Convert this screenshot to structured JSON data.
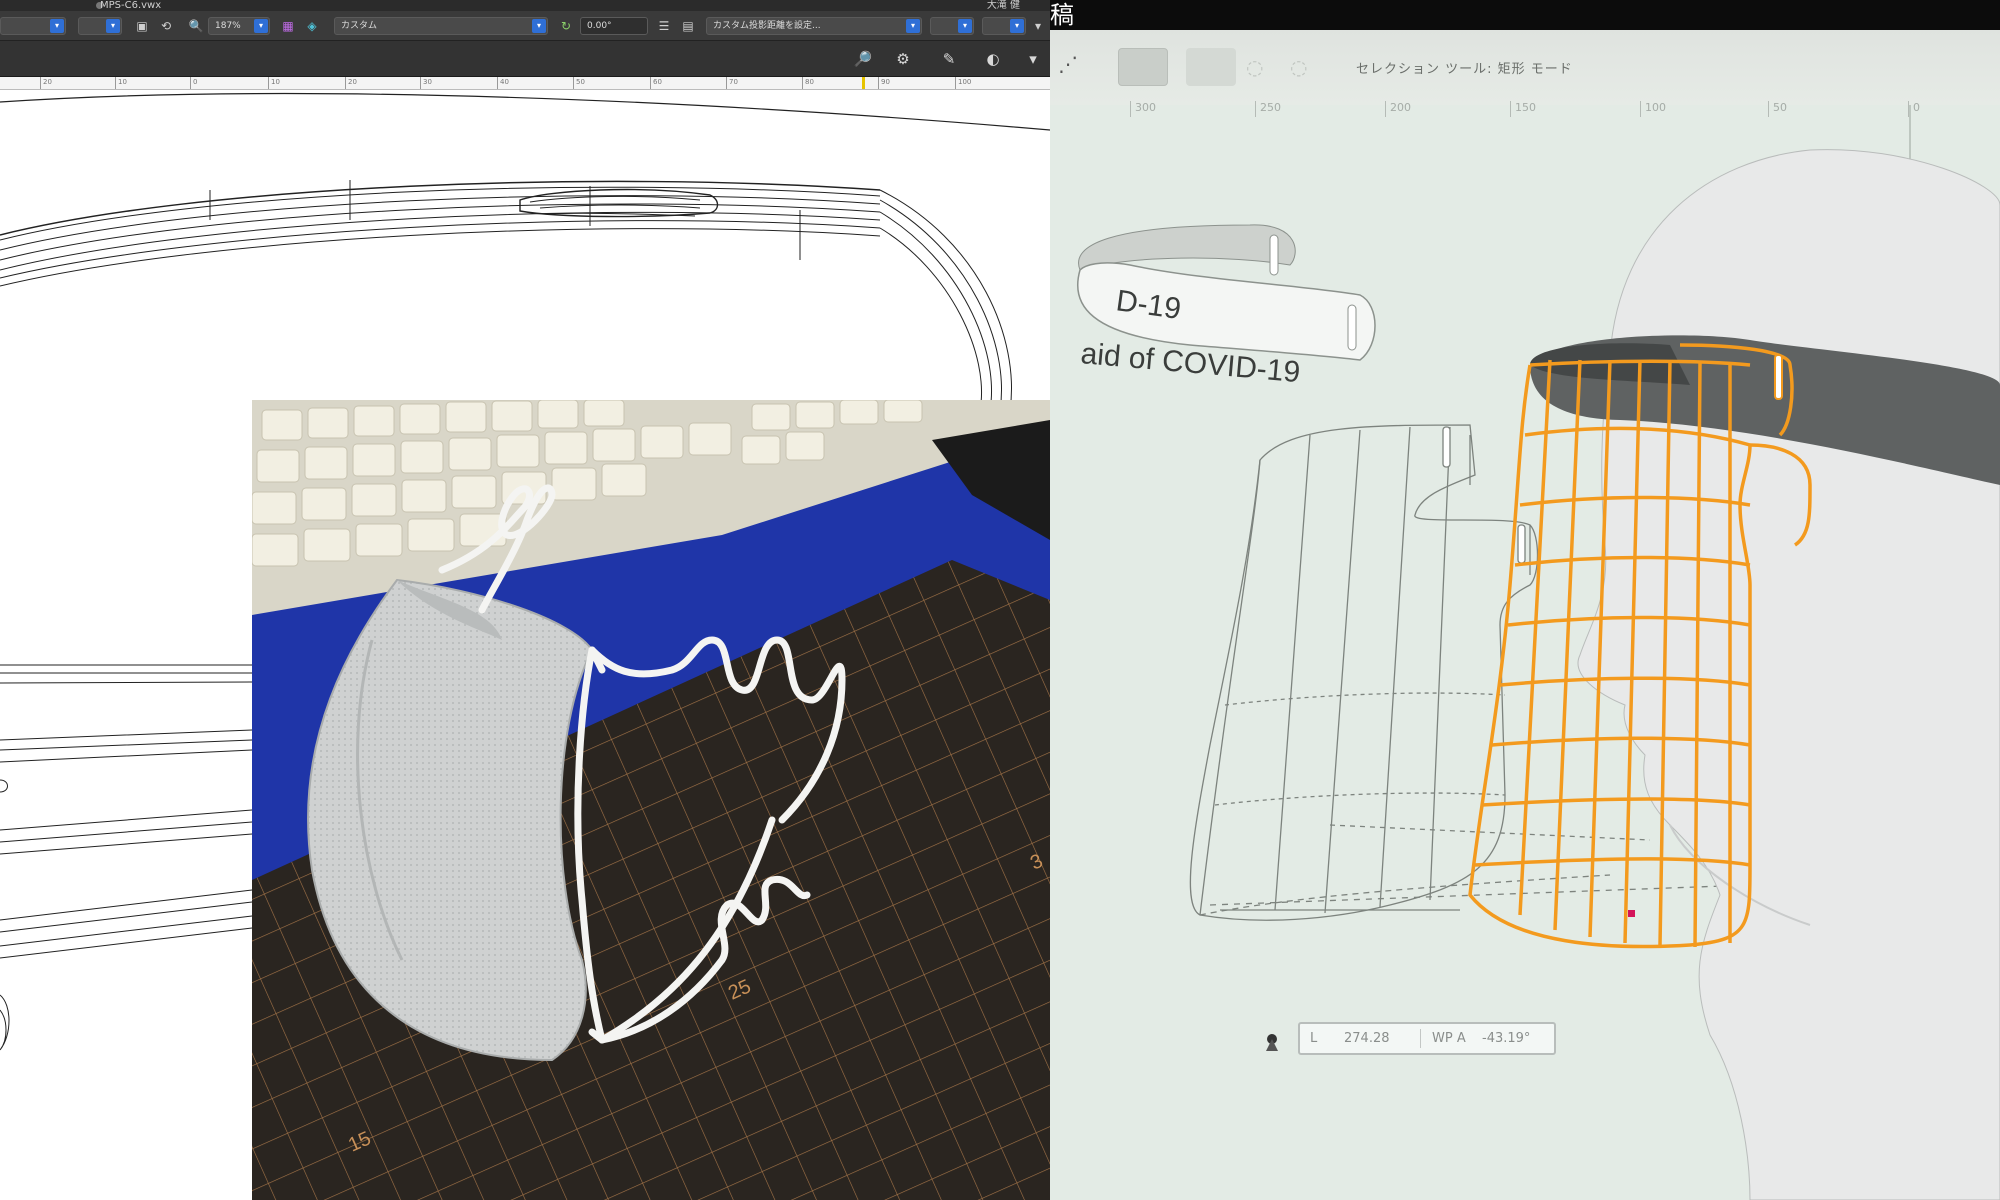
{
  "cad": {
    "filename": "MPS-C6.vwx",
    "owner": "大滝 健",
    "zoom": "187%",
    "view_select": "カスタム",
    "angle_value": "0.00°",
    "projection_select": "カスタム投影距離を設定...",
    "ruler_ticks": [
      "20",
      "10",
      "0",
      "10",
      "20",
      "30",
      "40",
      "50",
      "60",
      "70",
      "80",
      "90",
      "100"
    ]
  },
  "viewer": {
    "header_glyph": "稿",
    "status_text": "セレクション ツール: 矩形 モード",
    "ruler_ticks": [
      "300",
      "250",
      "200",
      "150",
      "100",
      "50",
      "0"
    ],
    "band_text_1": "D-19",
    "band_text_2": "aid of COVID-19",
    "readout": {
      "l_label": "L",
      "l_value": "274.28",
      "wpa_label": "WP A",
      "wpa_value": "-43.19°"
    },
    "colors": {
      "wire_orange": "#f39a1e",
      "background": "#e3ebe5"
    }
  },
  "photo": {
    "ruler_labels": [
      "15",
      "25",
      "3"
    ],
    "colors": {
      "mat_blue": "#1f35a8",
      "cutting_mat": "#2a2520",
      "grid": "#b07c4c",
      "mask": "#cfd1d1"
    }
  }
}
